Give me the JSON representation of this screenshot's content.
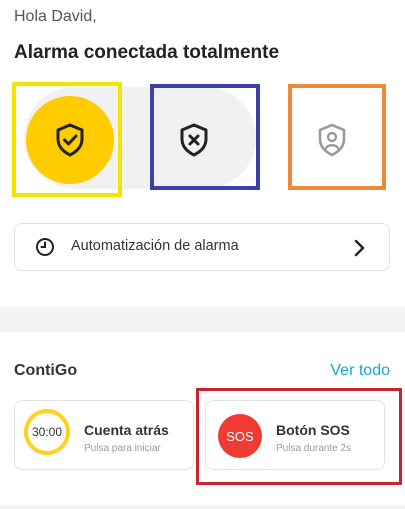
{
  "header": {
    "greeting": "Hola David,",
    "status_title": "Alarma conectada totalmente"
  },
  "alarm_modes": [
    {
      "name": "total",
      "icon": "shield-check-icon",
      "active": true,
      "color": "#ffcc00"
    },
    {
      "name": "off",
      "icon": "shield-x-icon",
      "active": false
    },
    {
      "name": "partial",
      "icon": "shield-person-icon",
      "active": false
    }
  ],
  "automation": {
    "label": "Automatización de alarma",
    "icon": "clock-icon",
    "chevron": "chevron-right-icon"
  },
  "contigo": {
    "title": "ContiGo",
    "see_all": "Ver todo",
    "cards": [
      {
        "id": "countdown",
        "badge": "30:00",
        "title": "Cuenta atrás",
        "subtitle": "Pulsa para iniciar"
      },
      {
        "id": "sos",
        "badge": "SOS",
        "title": "Botón SOS",
        "subtitle": "Pulsa durante 2s"
      }
    ]
  },
  "colors": {
    "accent_yellow": "#ffcc00",
    "link_blue": "#1aa5d6",
    "sos_red": "#ef3b34",
    "highlight_yellow": "#f3e300",
    "highlight_blue": "#3f3fa8",
    "highlight_orange": "#f0883a",
    "highlight_red": "#cc2333"
  }
}
